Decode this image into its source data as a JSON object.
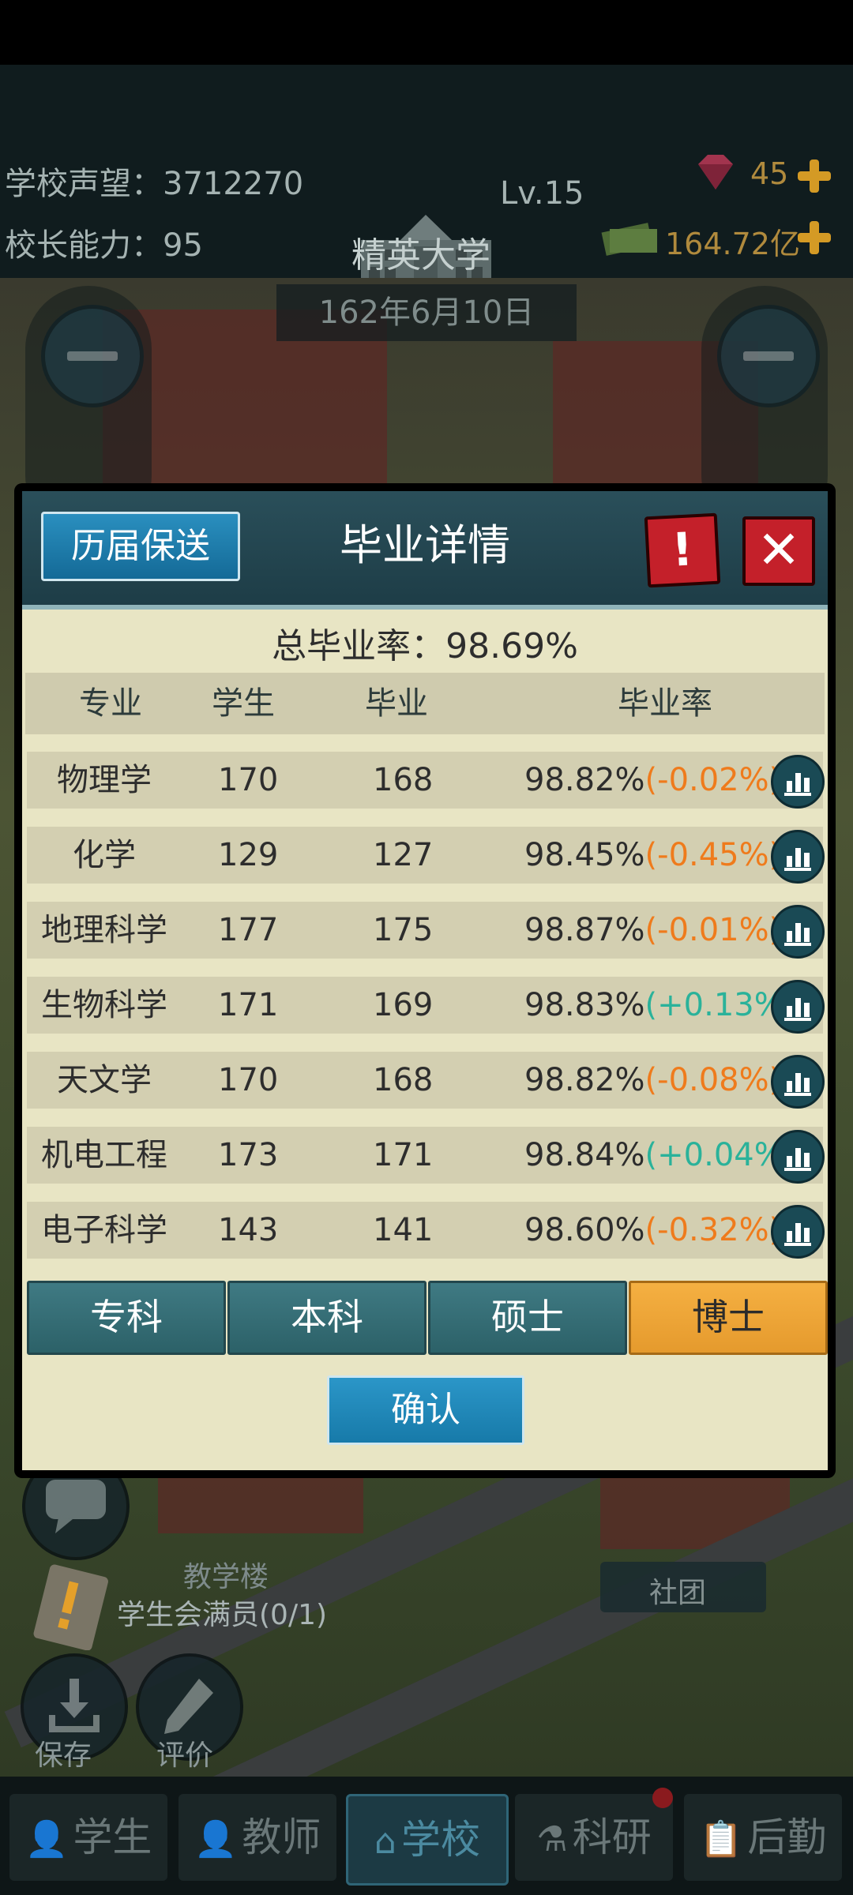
{
  "hud": {
    "reputation_label": "学校声望：3712270",
    "principal_label": "校长能力：95",
    "school_name": "精英大学",
    "level": "Lv.15",
    "gems": "45",
    "money": "164.72亿",
    "date": "162年6月10日"
  },
  "dialog": {
    "history_button": "历届保送",
    "title": "毕业详情",
    "info_icon": "exclamation-icon",
    "close_icon": "close-icon",
    "overall_rate": "总毕业率：98.69%",
    "columns": [
      "专业",
      "学生",
      "毕业",
      "毕业率"
    ],
    "rows": [
      {
        "major": "物理学",
        "students": "170",
        "graduated": "168",
        "rate": "98.82%",
        "delta": "(-0.02%)",
        "trend": "neg"
      },
      {
        "major": "化学",
        "students": "129",
        "graduated": "127",
        "rate": "98.45%",
        "delta": "(-0.45%)",
        "trend": "neg"
      },
      {
        "major": "地理科学",
        "students": "177",
        "graduated": "175",
        "rate": "98.87%",
        "delta": "(-0.01%)",
        "trend": "neg"
      },
      {
        "major": "生物科学",
        "students": "171",
        "graduated": "169",
        "rate": "98.83%",
        "delta": "(+0.13%)",
        "trend": "pos"
      },
      {
        "major": "天文学",
        "students": "170",
        "graduated": "168",
        "rate": "98.82%",
        "delta": "(-0.08%)",
        "trend": "neg"
      },
      {
        "major": "机电工程",
        "students": "173",
        "graduated": "171",
        "rate": "98.84%",
        "delta": "(+0.04%)",
        "trend": "pos"
      },
      {
        "major": "电子科学",
        "students": "143",
        "graduated": "141",
        "rate": "98.60%",
        "delta": "(-0.32%)",
        "trend": "neg"
      }
    ],
    "degree_tabs": [
      "专科",
      "本科",
      "硕士",
      "博士"
    ],
    "active_tab": "博士",
    "confirm_button": "确认"
  },
  "city": {
    "teaching_building": "教学楼",
    "student_council": "学生会满员(0/1)",
    "club": "社团",
    "save_label": "保存",
    "rate_label": "评价"
  },
  "nav": {
    "items": [
      "学生",
      "教师",
      "学校",
      "科研",
      "后勤"
    ],
    "active": "学校"
  },
  "colors": {
    "negative": "#ef7b1c",
    "positive": "#2ab29a",
    "active_tab": "#f5b042",
    "header": "#1d3c46"
  }
}
